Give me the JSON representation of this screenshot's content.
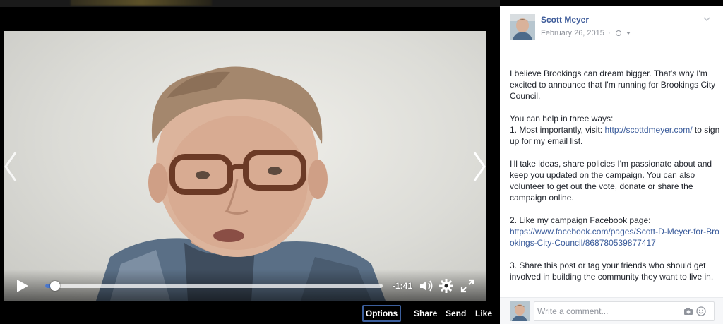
{
  "video": {
    "time_remaining": "-1:41",
    "progress_fraction": 0.03
  },
  "actions": {
    "options": "Options",
    "share": "Share",
    "send": "Send",
    "like": "Like"
  },
  "post": {
    "author": "Scott Meyer",
    "date": "February 26, 2015",
    "separator": "·",
    "paragraphs": [
      {
        "lines": [
          "I believe Brookings can dream bigger. That's why I'm excited to announce that I'm running for Brookings City Council."
        ]
      },
      {
        "lines": [
          "You can help in three ways:"
        ],
        "line2_prefix": "1. Most importantly, visit: ",
        "line2_link": "http://scottdmeyer.com/",
        "line2_suffix": " to sign up for my email list."
      },
      {
        "lines": [
          "I'll take ideas, share policies I'm passionate about and keep you updated on the campaign. You can also volunteer to get out the vote, donate or share the campaign online."
        ]
      },
      {
        "lines": [
          "2. Like my campaign Facebook page:"
        ],
        "link": "https://www.facebook.com/pages/Scott-D-Meyer-for-Brookings-City-Council/868780539877417"
      },
      {
        "lines": [
          "3. Share this post or tag your friends who should get involved in building the community they want to live in."
        ]
      }
    ]
  },
  "comment": {
    "placeholder": "Write a comment..."
  },
  "icons": {
    "play": "play-icon",
    "volume": "volume-icon",
    "settings": "gear-icon",
    "fullscreen": "fullscreen-icon",
    "prev": "chevron-left-icon",
    "next": "chevron-right-icon",
    "privacy": "globe-icon",
    "camera": "camera-icon",
    "emoji": "smiley-icon"
  },
  "colors": {
    "link": "#365899",
    "author": "#3b5998",
    "progress": "#4a76c9",
    "options_border": "#3b5e9c"
  }
}
